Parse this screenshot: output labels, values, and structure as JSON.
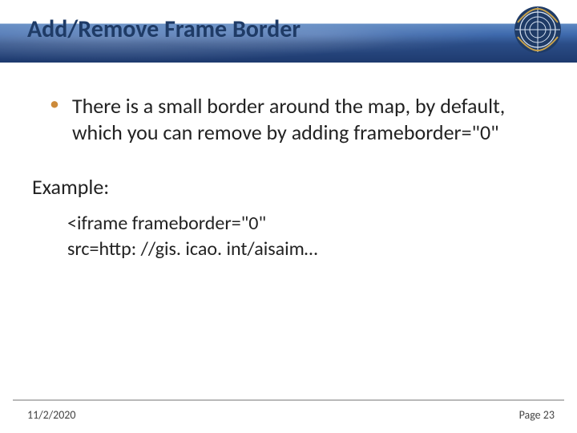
{
  "header": {
    "title": "Add/Remove Frame Border"
  },
  "body": {
    "bullet_text": "There is a small border around the map, by default, which you can remove by adding frameborder=\"0\"",
    "example_label": "Example:",
    "example_code_line1": "<iframe frameborder=\"0\"",
    "example_code_line2": "src=http: //gis. icao. int/aisaim…"
  },
  "footer": {
    "date": "11/2/2020",
    "page_label": "Page 23"
  },
  "logo": {
    "name": "icao-logo"
  }
}
